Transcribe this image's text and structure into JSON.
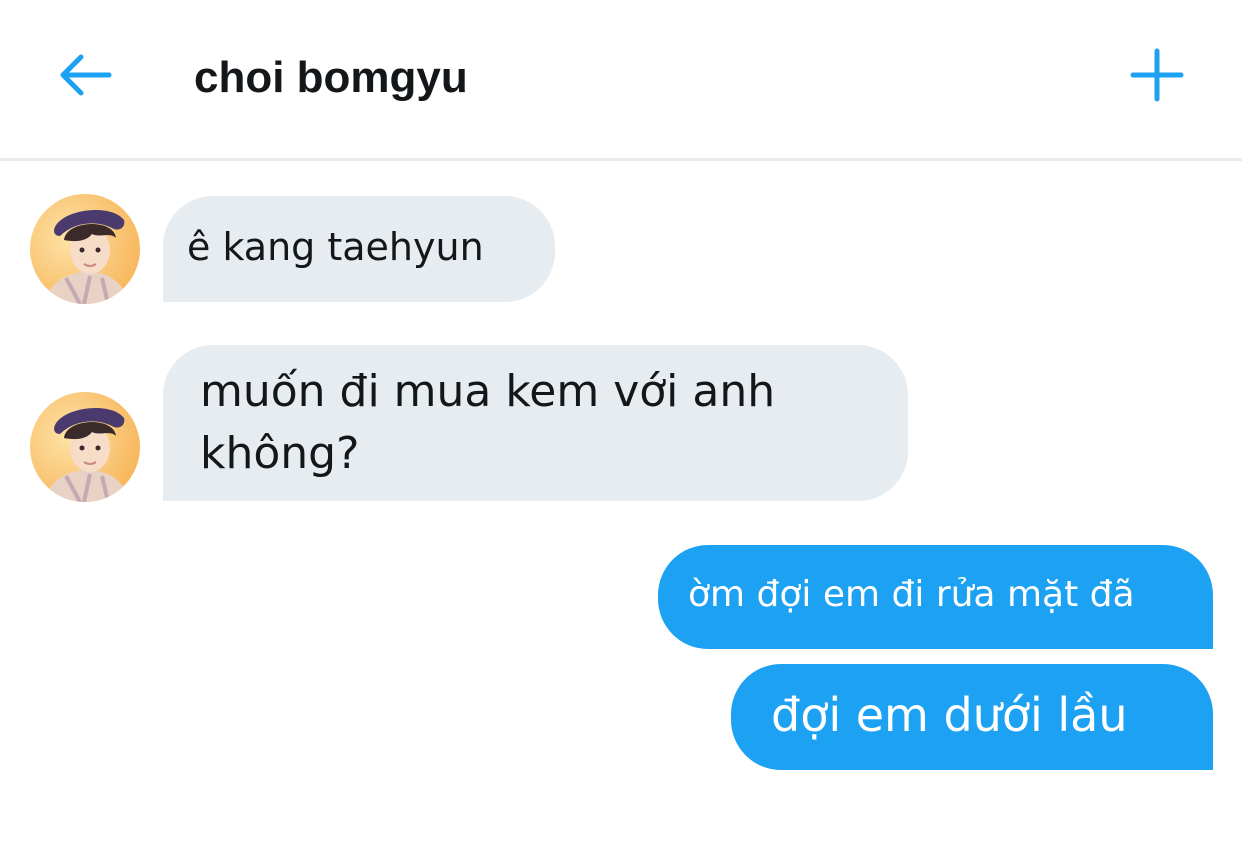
{
  "header": {
    "back_icon": "arrow-left-icon",
    "title": "choi bomgyu",
    "add_icon": "plus-icon"
  },
  "colors": {
    "accent": "#1da1f2",
    "incoming_bubble": "#e6ecf0",
    "outgoing_text": "#ffffff",
    "text": "#14171a"
  },
  "conversation": {
    "messages": [
      {
        "sender": "other",
        "text": "ê kang taehyun"
      },
      {
        "sender": "other",
        "text": "muốn đi mua kem với anh\nkhông?"
      },
      {
        "sender": "me",
        "text": "ờm đợi em đi rửa mặt đã"
      },
      {
        "sender": "me",
        "text": "đợi em dưới lầu"
      }
    ]
  }
}
